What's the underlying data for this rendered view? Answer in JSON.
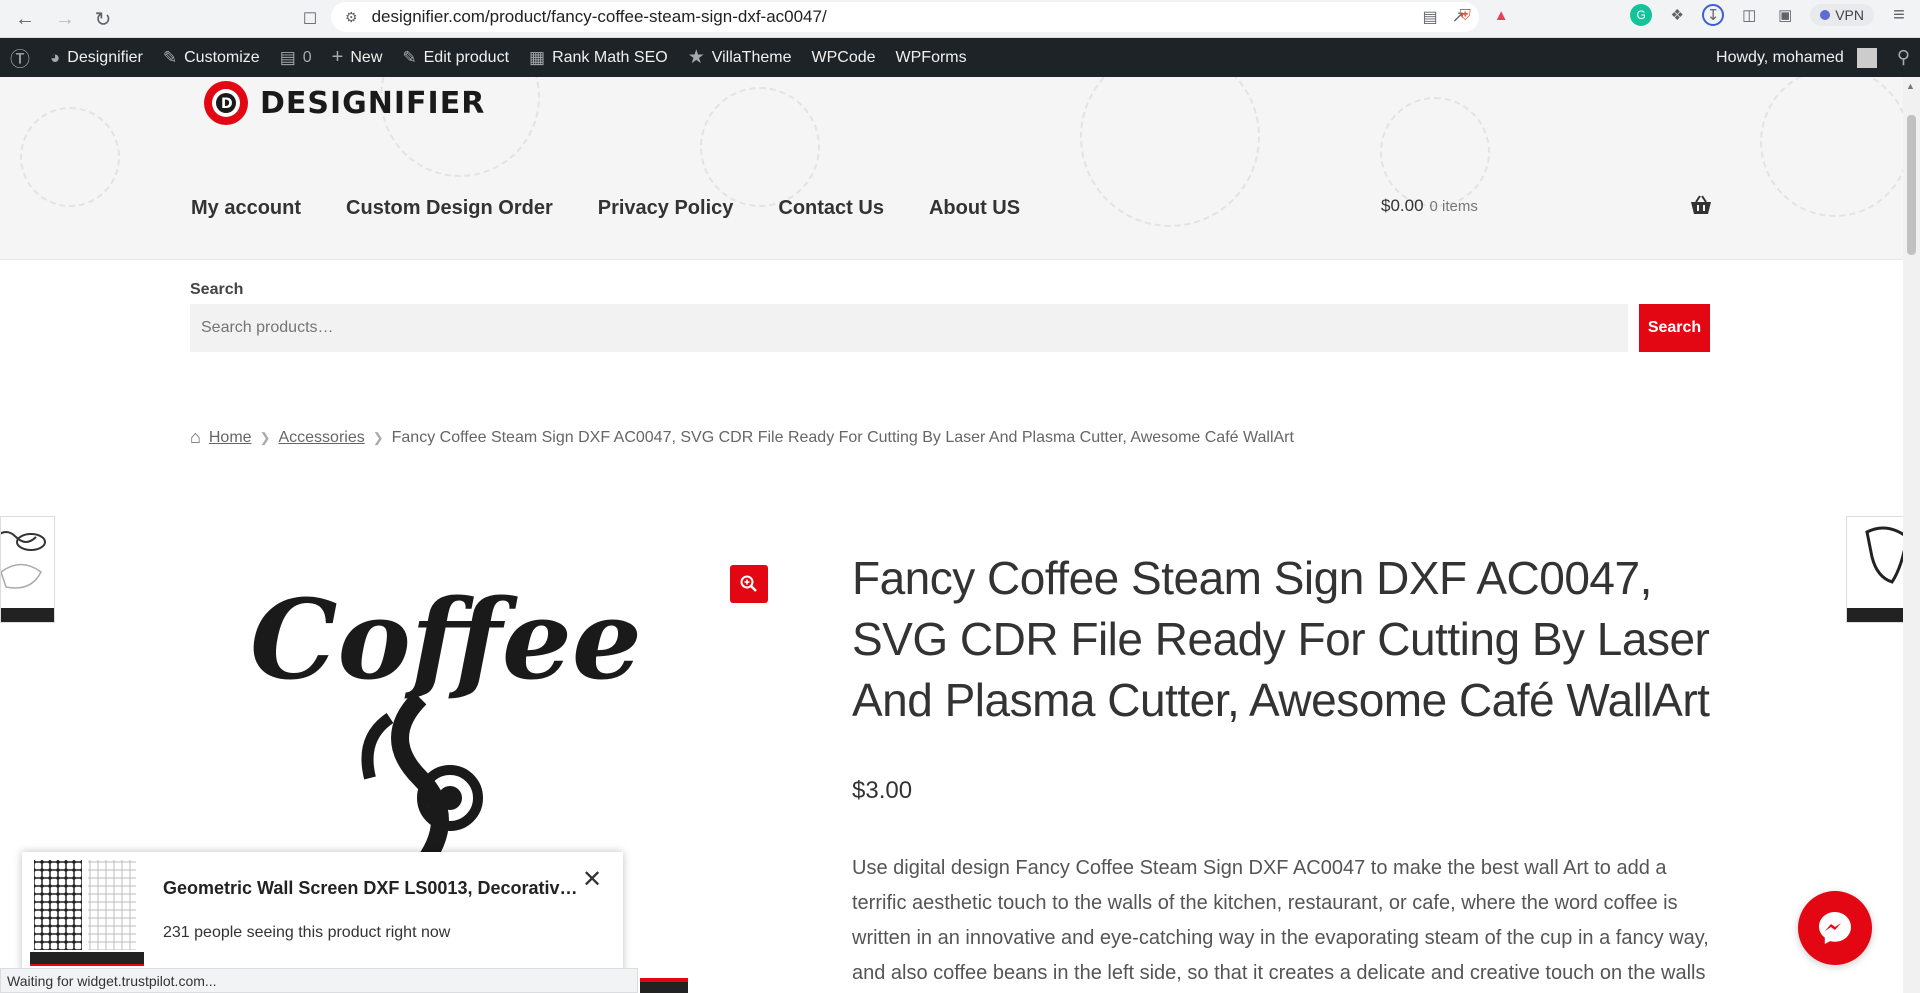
{
  "browser": {
    "url": "designifier.com/product/fancy-coffee-steam-sign-dxf-ac0047/",
    "vpn_label": "VPN"
  },
  "admin_bar": {
    "site_name": "Designifier",
    "customize": "Customize",
    "comments_count": "0",
    "new": "New",
    "edit_product": "Edit product",
    "rank_math": "Rank Math SEO",
    "villatheme": "VillaTheme",
    "wpcode": "WPCode",
    "wpforms": "WPForms",
    "howdy": "Howdy, mohamed"
  },
  "header": {
    "logo_text": "DESIGNIFIER",
    "nav": [
      "My account",
      "Custom Design Order",
      "Privacy Policy",
      "Contact Us",
      "About US"
    ],
    "cart_total": "$0.00",
    "cart_items": "0 items"
  },
  "search": {
    "label": "Search",
    "placeholder": "Search products…",
    "button": "Search"
  },
  "breadcrumb": {
    "home": "Home",
    "category": "Accessories",
    "current": "Fancy Coffee Steam Sign DXF AC0047, SVG CDR File Ready For Cutting By Laser And Plasma Cutter, Awesome Café WallArt"
  },
  "product": {
    "title": "Fancy Coffee Steam Sign DXF AC0047, SVG CDR File Ready For Cutting By Laser And Plasma Cutter, Awesome Café WallArt",
    "price": "$3.00",
    "description": "Use digital design Fancy Coffee Steam Sign DXF AC0047 to make the best wall Art to add a terrific aesthetic touch to the walls of the kitchen, restaurant, or cafe, where the word coffee is written in an innovative and eye-catching way in the evaporating steam of the cup in a fancy way, and also coffee beans in the left side, so that it creates a delicate and creative touch on the walls of",
    "image_word": "Coffee"
  },
  "popup": {
    "title": "Geometric Wall Screen DXF LS0013, Decorative...",
    "subtitle": "231 people seeing this product right now"
  },
  "status": "Waiting for widget.trustpilot.com...",
  "colors": {
    "accent": "#e30613",
    "admin_bar": "#1d2327"
  }
}
